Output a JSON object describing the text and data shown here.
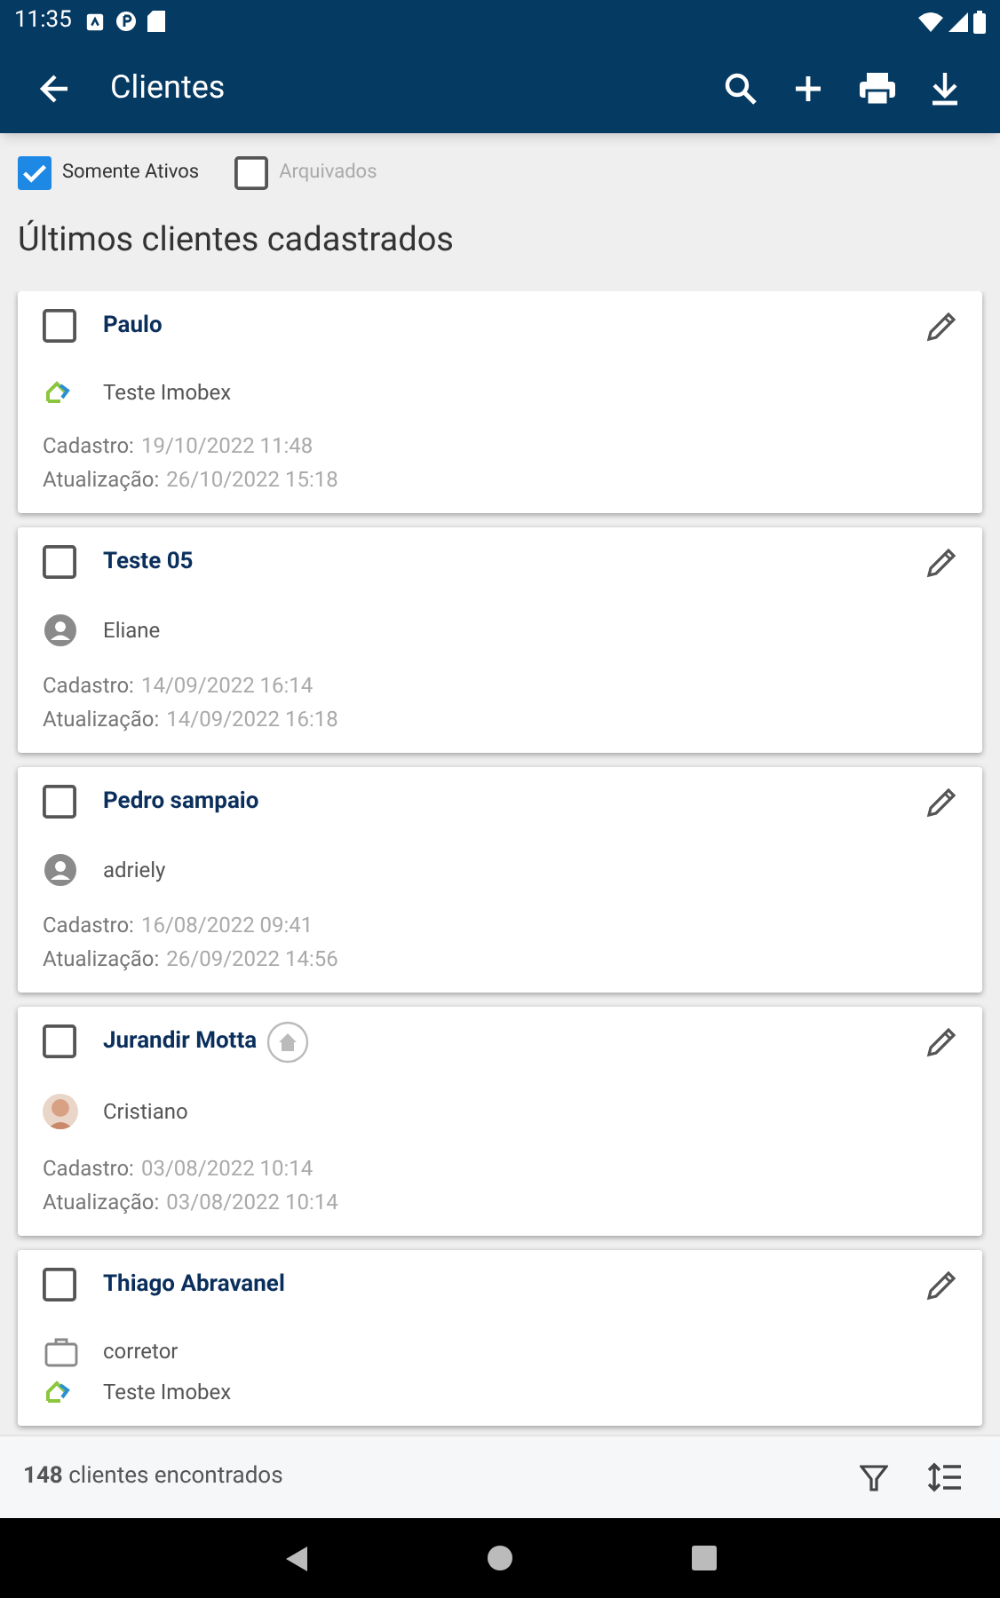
{
  "status_bar": {
    "time": "11:35"
  },
  "app_bar": {
    "title": "Clientes"
  },
  "filters": [
    {
      "label": "Somente Ativos",
      "checked": true
    },
    {
      "label": "Arquivados",
      "checked": false
    }
  ],
  "heading": "Últimos clientes cadastrados",
  "clients": [
    {
      "name": "Paulo",
      "checked": false,
      "home_badge": false,
      "details": [
        {
          "kind": "agency",
          "text": "Teste Imobex"
        }
      ],
      "created_label": "Cadastro:",
      "created": "19/10/2022 11:48",
      "updated_label": "Atualização:",
      "updated": "26/10/2022 15:18"
    },
    {
      "name": "Teste 05",
      "checked": false,
      "home_badge": false,
      "details": [
        {
          "kind": "user",
          "text": "Eliane"
        }
      ],
      "created_label": "Cadastro:",
      "created": "14/09/2022 16:14",
      "updated_label": "Atualização:",
      "updated": "14/09/2022 16:18"
    },
    {
      "name": "Pedro sampaio",
      "checked": false,
      "home_badge": false,
      "details": [
        {
          "kind": "user",
          "text": "adriely"
        }
      ],
      "created_label": "Cadastro:",
      "created": "16/08/2022 09:41",
      "updated_label": "Atualização:",
      "updated": "26/09/2022 14:56"
    },
    {
      "name": "Jurandir Motta",
      "checked": false,
      "home_badge": true,
      "details": [
        {
          "kind": "avatar",
          "text": "Cristiano"
        }
      ],
      "created_label": "Cadastro:",
      "created": "03/08/2022 10:14",
      "updated_label": "Atualização:",
      "updated": "03/08/2022 10:14"
    },
    {
      "name": "Thiago Abravanel",
      "checked": false,
      "home_badge": false,
      "details": [
        {
          "kind": "role",
          "text": "corretor"
        },
        {
          "kind": "agency",
          "text": "Teste Imobex"
        }
      ]
    }
  ],
  "footer": {
    "count": "**148** clientes encontrados"
  }
}
